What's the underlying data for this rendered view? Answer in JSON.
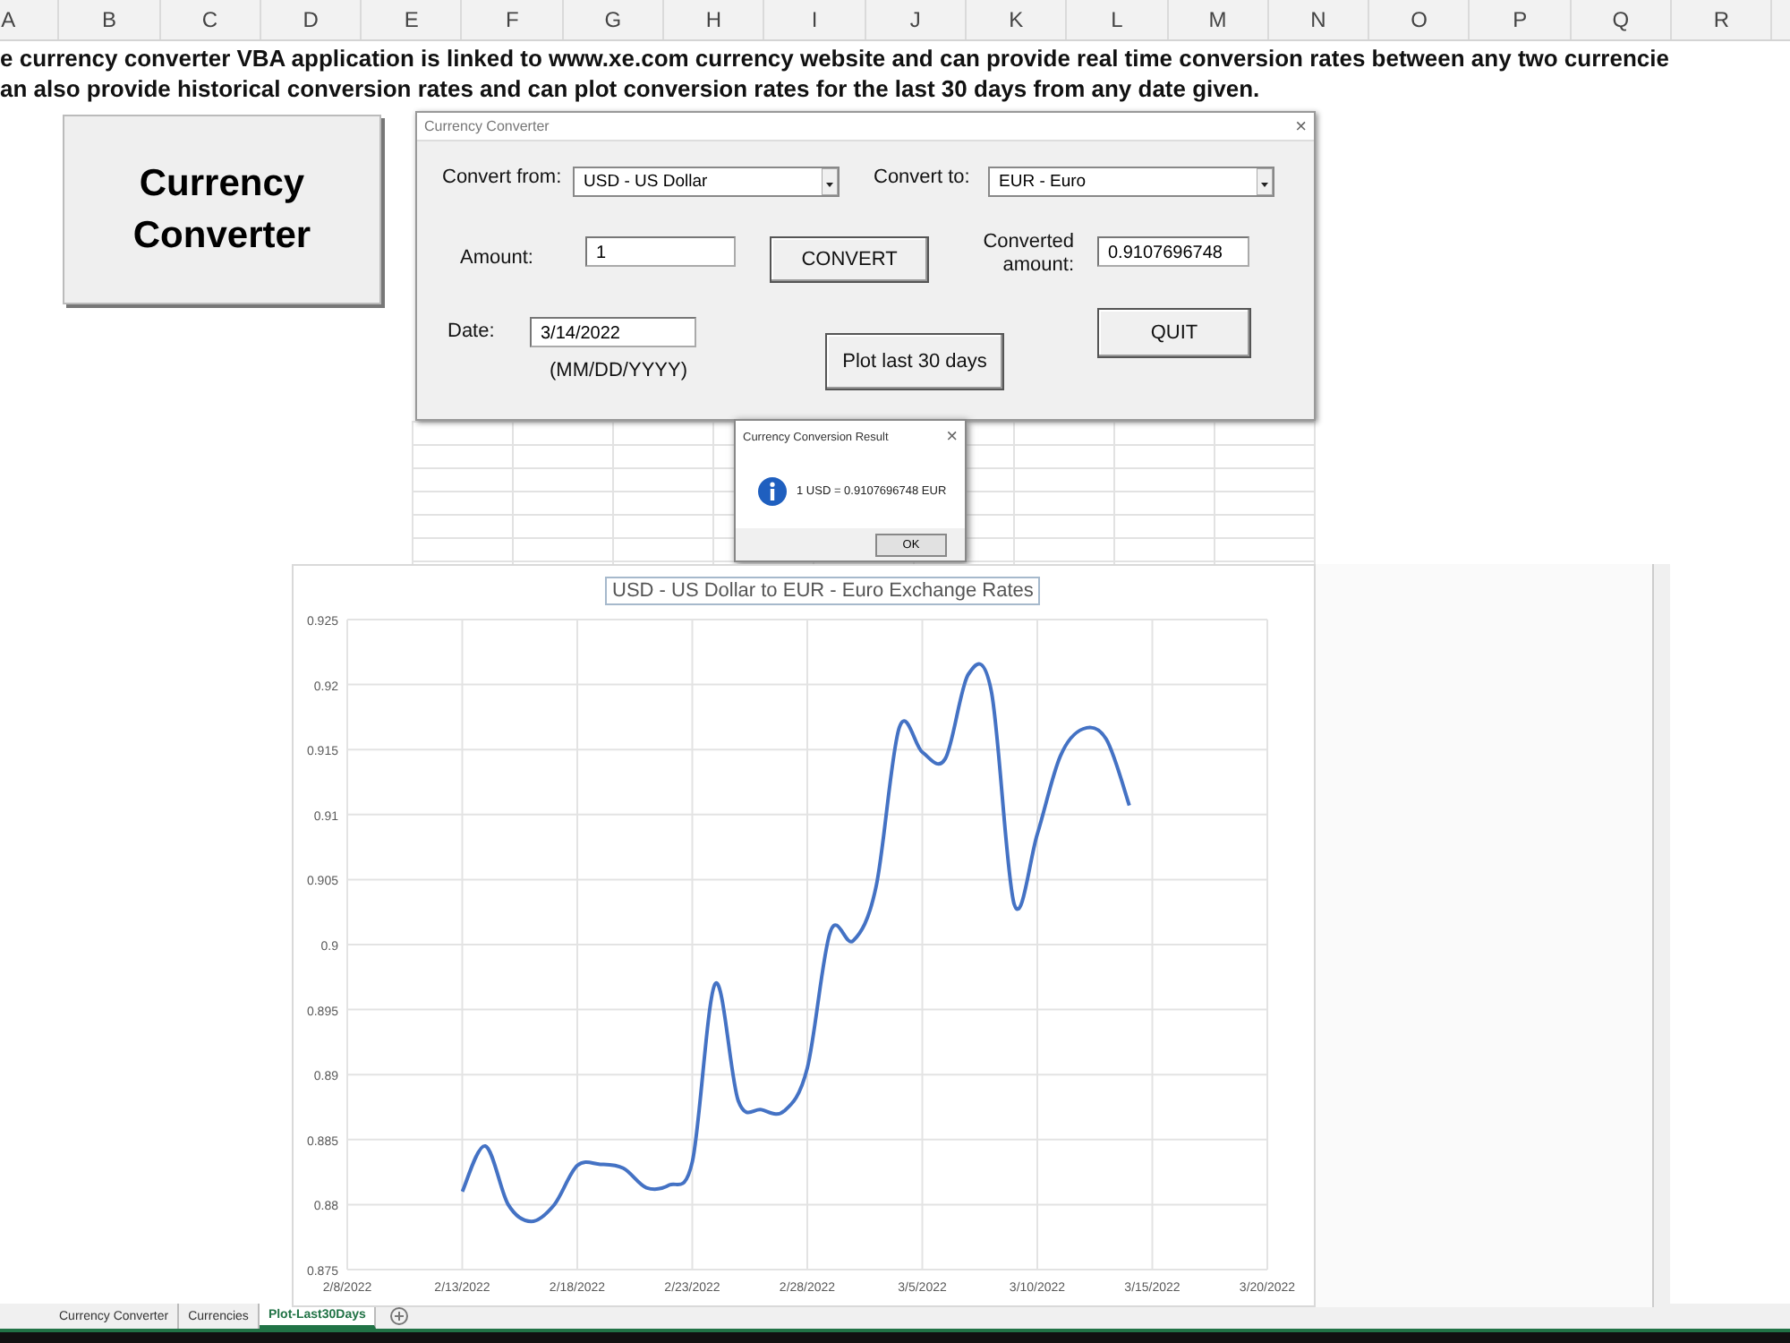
{
  "column_headers": [
    "A",
    "B",
    "C",
    "D",
    "E",
    "F",
    "G",
    "H",
    "I",
    "J",
    "K",
    "L",
    "M",
    "N",
    "O",
    "P",
    "Q",
    "R"
  ],
  "description_lines": [
    "e currency converter VBA application is linked to www.xe.com currency website and can provide real time conversion rates between any two currencie",
    "an also provide historical conversion rates and can plot conversion rates for the last 30 days from any date given."
  ],
  "shape_button": {
    "label": "Currency Converter"
  },
  "userform": {
    "title": "Currency Converter",
    "close": "×",
    "convert_from": {
      "label": "Convert from:",
      "value": "USD - US Dollar"
    },
    "convert_to": {
      "label": "Convert to:",
      "value": "EUR - Euro"
    },
    "amount": {
      "label": "Amount:",
      "value": "1"
    },
    "convert_button": "CONVERT",
    "converted_amount": {
      "label": "Converted amount:",
      "value": "0.9107696748"
    },
    "date": {
      "label": "Date:",
      "value": "3/14/2022",
      "hint": "(MM/DD/YYYY)"
    },
    "plot_button": "Plot last 30 days",
    "quit_button": "QUIT"
  },
  "message_box": {
    "title": "Currency Conversion Result",
    "close": "×",
    "message": "1 USD = 0.9107696748 EUR",
    "ok_button": "OK"
  },
  "chart": {
    "chart_data": {
      "type": "line",
      "title": "USD - US Dollar to EUR - Euro Exchange Rates",
      "categories": [
        "2/8/2022",
        null,
        null,
        null,
        null,
        "2/13/2022",
        null,
        null,
        null,
        null,
        "2/18/2022",
        null,
        null,
        null,
        null,
        "2/23/2022",
        null,
        null,
        null,
        null,
        "2/28/2022",
        null,
        null,
        null,
        null,
        "3/5/2022",
        null,
        null,
        null,
        null,
        "3/10/2022",
        null,
        null,
        null,
        null,
        "3/15/2022",
        null,
        null,
        null,
        null,
        "3/20/2022"
      ],
      "series": [
        {
          "color": "#4472c4",
          "values": [
            null,
            null,
            null,
            null,
            null,
            0.881,
            0.8845,
            0.88,
            0.8787,
            0.88,
            0.883,
            0.8831,
            0.8828,
            0.8813,
            0.8815,
            0.8833,
            0.897,
            0.888,
            0.8873,
            0.8872,
            0.8905,
            0.901,
            0.9003,
            0.9045,
            0.9167,
            0.9148,
            0.9143,
            0.9208,
            0.9195,
            0.9031,
            0.9085,
            0.9145,
            0.9166,
            0.9158,
            0.9107,
            null,
            null,
            null,
            null,
            null,
            null
          ]
        }
      ],
      "grid": true,
      "ylim": [
        0.875,
        0.925
      ],
      "yticks": [
        0.875,
        0.88,
        0.885,
        0.89,
        0.895,
        0.9,
        0.905,
        0.91,
        0.915,
        0.92,
        0.925
      ]
    }
  },
  "sheet_tabs": [
    {
      "label": "Currency Converter",
      "selected": false
    },
    {
      "label": "Currencies",
      "selected": false
    },
    {
      "label": "Plot-Last30Days",
      "selected": true
    }
  ]
}
